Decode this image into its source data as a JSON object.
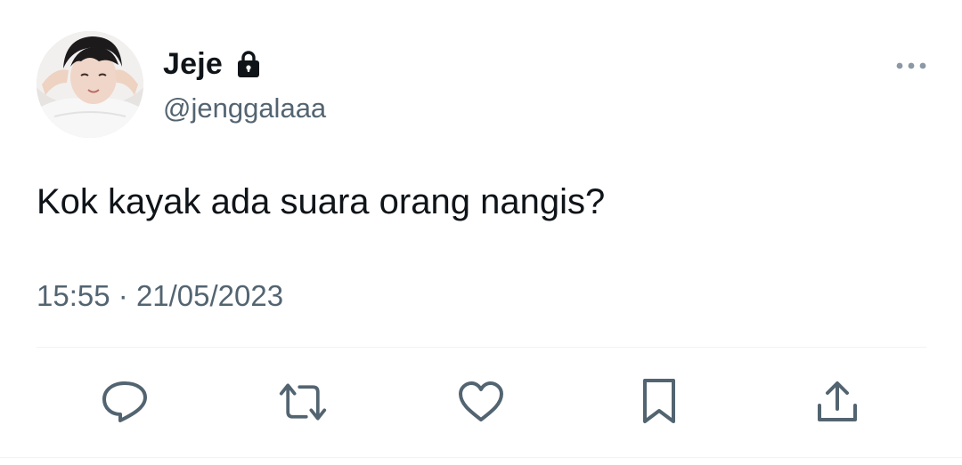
{
  "user": {
    "display_name": "Jeje",
    "handle": "@jenggalaaa",
    "protected_icon": "lock-icon",
    "avatar": "profile-photo"
  },
  "tweet": {
    "text": "Kok kayak ada suara orang nangis?",
    "time": "15:55",
    "separator": "·",
    "date": "21/05/2023"
  },
  "actions": {
    "reply_icon": "reply-icon",
    "retweet_icon": "retweet-icon",
    "like_icon": "heart-icon",
    "bookmark_icon": "bookmark-icon",
    "share_icon": "share-icon"
  },
  "menu": {
    "more_icon": "more-icon"
  },
  "colors": {
    "text_primary": "#0f1419",
    "text_secondary": "#536471",
    "icon": "#536471",
    "divider": "#eff3f4"
  }
}
